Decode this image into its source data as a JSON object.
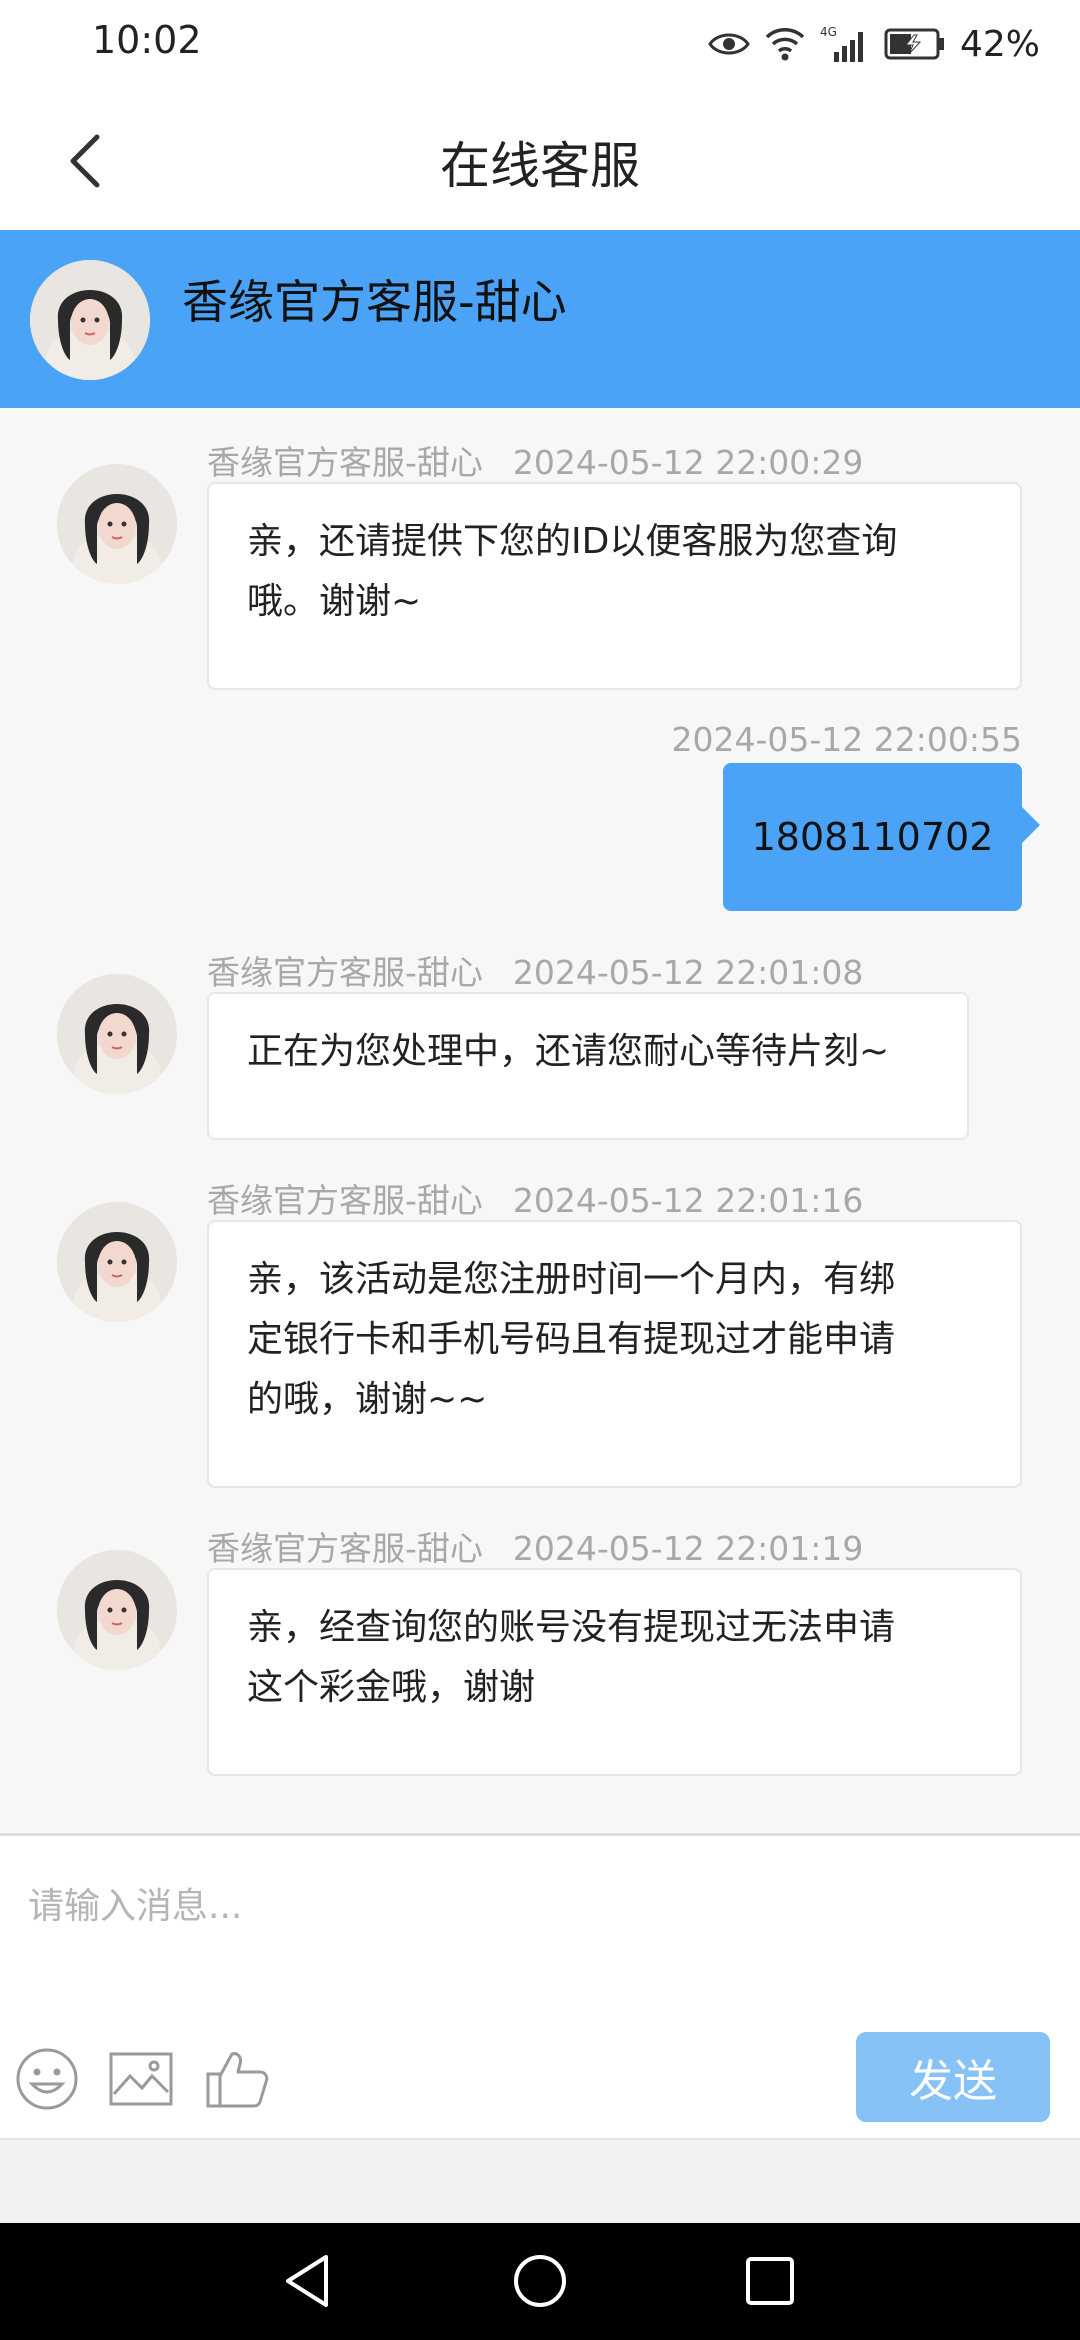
{
  "status": {
    "time": "10:02",
    "battery": "42%"
  },
  "header": {
    "title": "在线客服"
  },
  "agent": {
    "name": "香缘官方客服-甜心"
  },
  "messages": [
    {
      "from": "agent",
      "sender": "香缘官方客服-甜心",
      "time": "2024-05-12 22:00:29",
      "lines": [
        "亲，还请提供下您的ID以便客服为您查询",
        "哦。谢谢~"
      ]
    },
    {
      "from": "user",
      "time": "2024-05-12 22:00:55",
      "text": "1808110702"
    },
    {
      "from": "agent",
      "sender": "香缘官方客服-甜心",
      "time": "2024-05-12 22:01:08",
      "lines": [
        "正在为您处理中，还请您耐心等待片刻~"
      ]
    },
    {
      "from": "agent",
      "sender": "香缘官方客服-甜心",
      "time": "2024-05-12 22:01:16",
      "lines": [
        "亲，该活动是您注册时间一个月内，有绑",
        "定银行卡和手机号码且有提现过才能申请",
        "的哦，谢谢~~"
      ]
    },
    {
      "from": "agent",
      "sender": "香缘官方客服-甜心",
      "time": "2024-05-12 22:01:19",
      "lines": [
        "亲，经查询您的账号没有提现过无法申请",
        "这个彩金哦，谢谢"
      ]
    }
  ],
  "input": {
    "placeholder": "请输入消息...",
    "value": "",
    "send_label": "发送"
  },
  "toolbar_icons": [
    "emoji-icon",
    "image-icon",
    "thumbs-up-icon"
  ],
  "colors": {
    "accent": "#4aa3f7",
    "send_button": "#87c2f7"
  }
}
